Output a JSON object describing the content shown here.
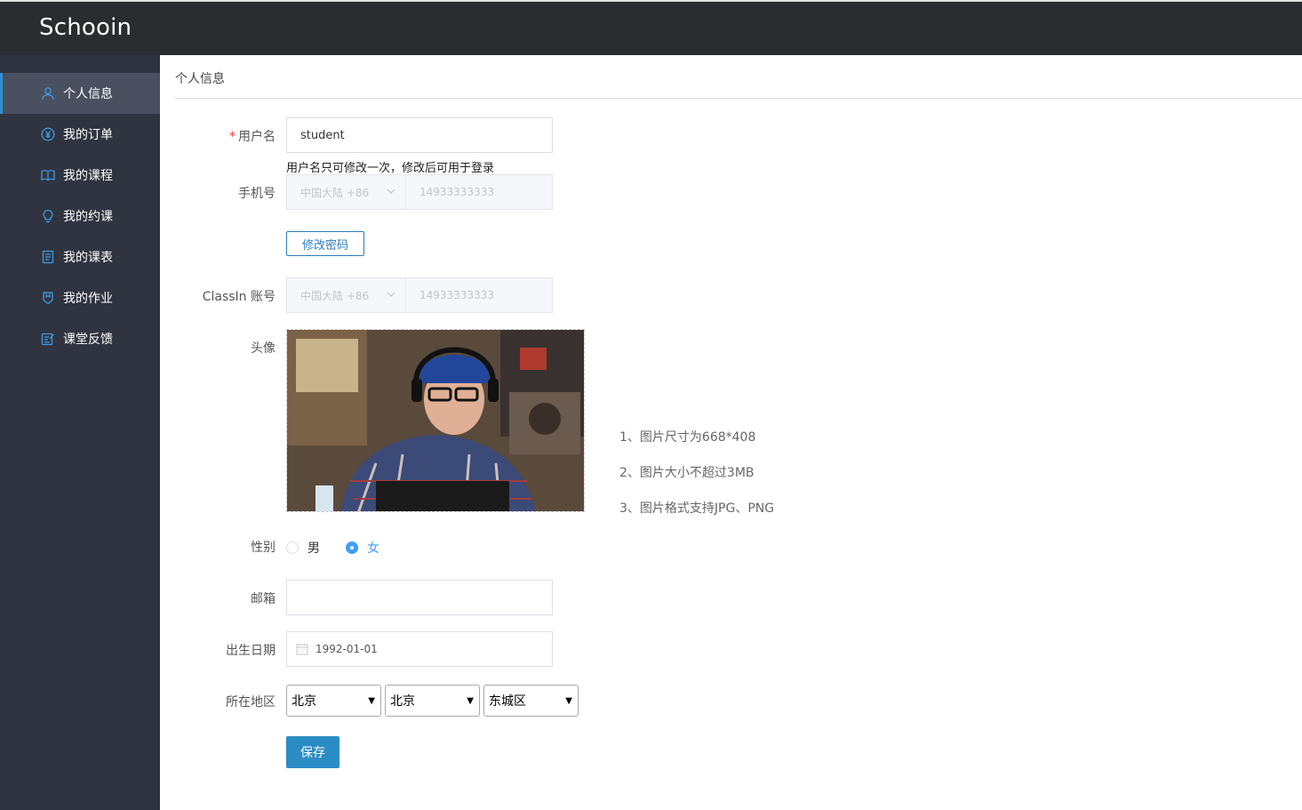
{
  "app": {
    "brand": "Schooin"
  },
  "sidebar": {
    "items": [
      {
        "label": "个人信息",
        "icon": "user-icon",
        "active": true
      },
      {
        "label": "我的订单",
        "icon": "yen-icon"
      },
      {
        "label": "我的课程",
        "icon": "book-icon"
      },
      {
        "label": "我的约课",
        "icon": "bulb-icon"
      },
      {
        "label": "我的课表",
        "icon": "schedule-icon"
      },
      {
        "label": "我的作业",
        "icon": "homework-icon"
      },
      {
        "label": "课堂反馈",
        "icon": "feedback-icon"
      }
    ]
  },
  "breadcrumb": "个人信息",
  "form": {
    "username": {
      "required_mark": "*",
      "label": "用户名",
      "value": "student",
      "hint": "用户名只可修改一次，修改后可用于登录"
    },
    "phone": {
      "label": "手机号",
      "country": "中国大陆 +86",
      "number": "14933333333"
    },
    "change_password": "修改密码",
    "classin": {
      "label": "ClassIn 账号",
      "country": "中国大陆 +86",
      "number": "14933333333"
    },
    "avatar": {
      "label": "头像",
      "tips": [
        "1、图片尺寸为668*408",
        "2、图片大小不超过3MB",
        "3、图片格式支持JPG、PNG"
      ]
    },
    "gender": {
      "label": "性别",
      "options": [
        "男",
        "女"
      ],
      "selected": "女"
    },
    "email": {
      "label": "邮箱",
      "value": ""
    },
    "birthday": {
      "label": "出生日期",
      "value": "1992-01-01"
    },
    "region": {
      "label": "所在地区",
      "province": "北京",
      "city": "北京",
      "district": "东城区"
    },
    "save": "保存"
  },
  "colors": {
    "accent": "#2b8cc4",
    "radio_checked": "#409eff",
    "topbar": "#2b2c30",
    "sidebar": "#303440"
  }
}
